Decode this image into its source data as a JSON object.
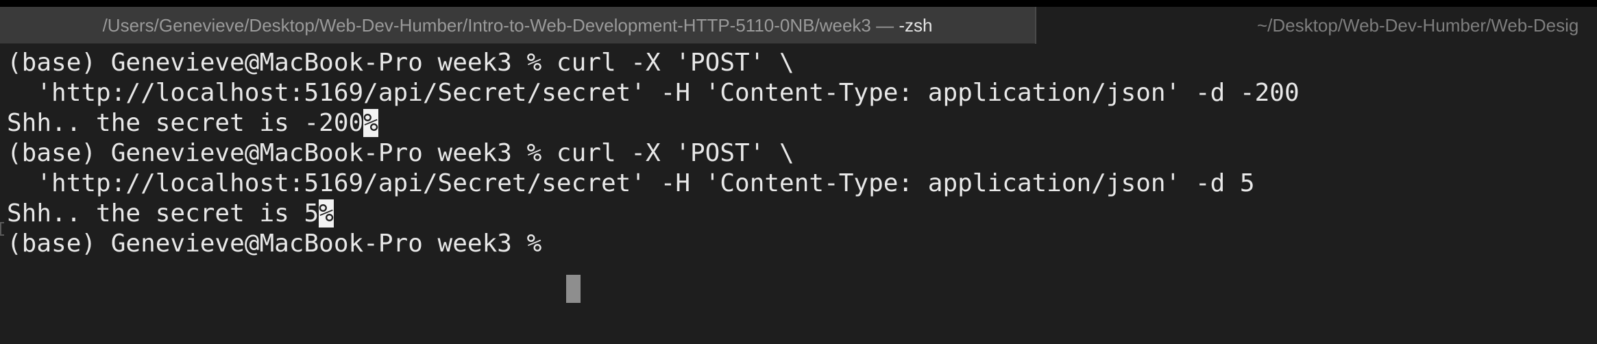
{
  "window": {
    "tabs": [
      {
        "title": "/Users/Genevieve/Desktop/Web-Dev-Humber/Intro-to-Web-Development-HTTP-5110-0NB/week3 — ",
        "shell": "-zsh",
        "active": true
      },
      {
        "title": "~/Desktop/Web-Dev-Humber/Web-Desig",
        "active": false
      }
    ]
  },
  "terminal": {
    "lines": [
      "(base) Genevieve@MacBook-Pro week3 % curl -X 'POST' \\",
      "  'http://localhost:5169/api/Secret/secret' -H 'Content-Type: application/json' -d -200",
      "Shh.. the secret is -200",
      "(base) Genevieve@MacBook-Pro week3 % curl -X 'POST' \\",
      "  'http://localhost:5169/api/Secret/secret' -H 'Content-Type: application/json' -d 5",
      "Shh.. the secret is 5",
      "(base) Genevieve@MacBook-Pro week3 % "
    ],
    "no_newline_marker": "%"
  },
  "colors": {
    "background": "#1e1e1e",
    "foreground": "#e8e8e8",
    "active_tab": "#3a3a3a",
    "cursor": "#8e8e8e"
  }
}
